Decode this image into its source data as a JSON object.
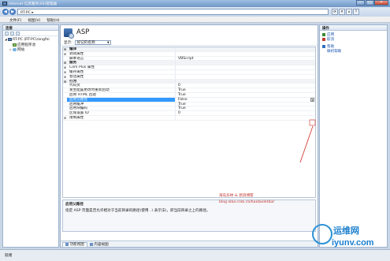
{
  "window": {
    "title": "Internet 信息服务(IIS)管理器"
  },
  "address": {
    "path": "RT-PC ▸"
  },
  "menu": {
    "file": "文件(F)",
    "view": "视图(V)",
    "help": "帮助(H)"
  },
  "connections": {
    "title": "连接",
    "tree": [
      {
        "label": "RT-PC (RT-PC\\rongfei",
        "level": 0,
        "icon": "server-icon",
        "toggle": "◢"
      },
      {
        "label": "应用程序池",
        "level": 1,
        "icon": "app-pool-icon",
        "toggle": ""
      },
      {
        "label": "网站",
        "level": 1,
        "icon": "sites-icon",
        "toggle": "▷"
      }
    ]
  },
  "feature": {
    "title": "ASP",
    "display_label": "显示:",
    "display_value": "好记的名称"
  },
  "properties": [
    {
      "name": "编译",
      "value": "",
      "type": "cat",
      "toggle": "⊟"
    },
    {
      "name": "调试属性",
      "value": "",
      "type": "sub",
      "toggle": "⊞"
    },
    {
      "name": "脚本语言",
      "value": "VBScript",
      "type": "item",
      "toggle": ""
    },
    {
      "name": "服务",
      "value": "",
      "type": "cat",
      "toggle": "⊟"
    },
    {
      "name": "Com Plus 属性",
      "value": "",
      "type": "sub",
      "toggle": "⊞"
    },
    {
      "name": "缓存属性",
      "value": "",
      "type": "sub",
      "toggle": "⊞"
    },
    {
      "name": "会话属性",
      "value": "",
      "type": "sub",
      "toggle": "⊞"
    },
    {
      "name": "行为",
      "value": "",
      "type": "cat",
      "toggle": "⊟"
    },
    {
      "name": "代码页",
      "value": "0",
      "type": "item",
      "toggle": ""
    },
    {
      "name": "发生配置更改时重新启动",
      "value": "True",
      "type": "item",
      "toggle": ""
    },
    {
      "name": "启用 HTML 回退",
      "value": "True",
      "type": "item",
      "toggle": ""
    },
    {
      "name": "启用父路径",
      "value": "False",
      "type": "sel",
      "toggle": ""
    },
    {
      "name": "启用缓冲",
      "value": "True",
      "type": "item",
      "toggle": ""
    },
    {
      "name": "启用块编码",
      "value": "True",
      "type": "item",
      "toggle": ""
    },
    {
      "name": "区域设置 ID",
      "value": "0",
      "type": "item",
      "toggle": ""
    },
    {
      "name": "限制属性",
      "value": "",
      "type": "sub",
      "toggle": "⊞"
    }
  ],
  "description": {
    "title": "启用父路径",
    "text": "指定 ASP 页面是否允许相对于当前目录的路径(使用 ..\\ 表示法)，即当前目录之上的路径。"
  },
  "tabs": {
    "features": "功能视图",
    "content": "内容视图"
  },
  "actions": {
    "title": "操作",
    "items": [
      {
        "label": "应用",
        "icon": "apply-icon",
        "color": "#3a8a2e"
      },
      {
        "label": "取消",
        "icon": "cancel-icon",
        "color": "#c23b2b"
      },
      {
        "label": "帮助",
        "icon": "help-icon",
        "color": "#2f6fc1"
      },
      {
        "label": "联机帮助",
        "icon": "",
        "color": ""
      }
    ]
  },
  "status": {
    "text": "就绪"
  },
  "watermark": {
    "line1": "海岛乐林 & 新浪博客",
    "line2": "blog.sina.com.cn/haidaolethar"
  },
  "logo": {
    "cn": "运维网",
    "en": "iyunv.com"
  }
}
